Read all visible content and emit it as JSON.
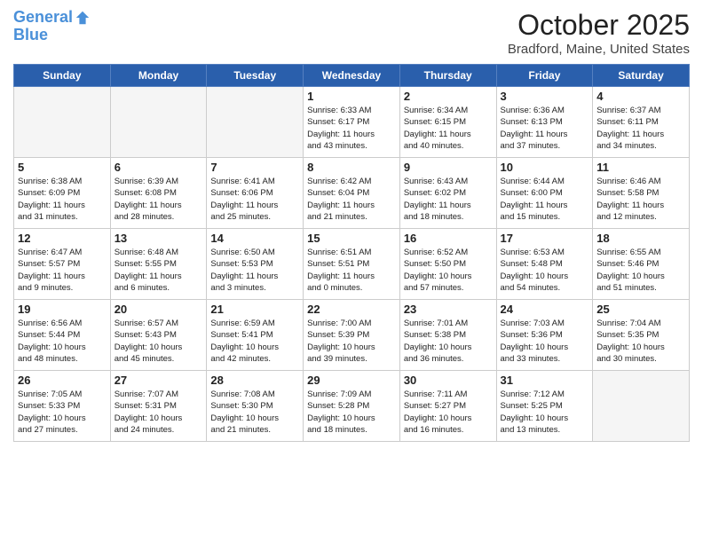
{
  "header": {
    "logo_line1": "General",
    "logo_line2": "Blue",
    "title": "October 2025",
    "subtitle": "Bradford, Maine, United States"
  },
  "weekdays": [
    "Sunday",
    "Monday",
    "Tuesday",
    "Wednesday",
    "Thursday",
    "Friday",
    "Saturday"
  ],
  "weeks": [
    [
      {
        "day": "",
        "info": ""
      },
      {
        "day": "",
        "info": ""
      },
      {
        "day": "",
        "info": ""
      },
      {
        "day": "1",
        "info": "Sunrise: 6:33 AM\nSunset: 6:17 PM\nDaylight: 11 hours\nand 43 minutes."
      },
      {
        "day": "2",
        "info": "Sunrise: 6:34 AM\nSunset: 6:15 PM\nDaylight: 11 hours\nand 40 minutes."
      },
      {
        "day": "3",
        "info": "Sunrise: 6:36 AM\nSunset: 6:13 PM\nDaylight: 11 hours\nand 37 minutes."
      },
      {
        "day": "4",
        "info": "Sunrise: 6:37 AM\nSunset: 6:11 PM\nDaylight: 11 hours\nand 34 minutes."
      }
    ],
    [
      {
        "day": "5",
        "info": "Sunrise: 6:38 AM\nSunset: 6:09 PM\nDaylight: 11 hours\nand 31 minutes."
      },
      {
        "day": "6",
        "info": "Sunrise: 6:39 AM\nSunset: 6:08 PM\nDaylight: 11 hours\nand 28 minutes."
      },
      {
        "day": "7",
        "info": "Sunrise: 6:41 AM\nSunset: 6:06 PM\nDaylight: 11 hours\nand 25 minutes."
      },
      {
        "day": "8",
        "info": "Sunrise: 6:42 AM\nSunset: 6:04 PM\nDaylight: 11 hours\nand 21 minutes."
      },
      {
        "day": "9",
        "info": "Sunrise: 6:43 AM\nSunset: 6:02 PM\nDaylight: 11 hours\nand 18 minutes."
      },
      {
        "day": "10",
        "info": "Sunrise: 6:44 AM\nSunset: 6:00 PM\nDaylight: 11 hours\nand 15 minutes."
      },
      {
        "day": "11",
        "info": "Sunrise: 6:46 AM\nSunset: 5:58 PM\nDaylight: 11 hours\nand 12 minutes."
      }
    ],
    [
      {
        "day": "12",
        "info": "Sunrise: 6:47 AM\nSunset: 5:57 PM\nDaylight: 11 hours\nand 9 minutes."
      },
      {
        "day": "13",
        "info": "Sunrise: 6:48 AM\nSunset: 5:55 PM\nDaylight: 11 hours\nand 6 minutes."
      },
      {
        "day": "14",
        "info": "Sunrise: 6:50 AM\nSunset: 5:53 PM\nDaylight: 11 hours\nand 3 minutes."
      },
      {
        "day": "15",
        "info": "Sunrise: 6:51 AM\nSunset: 5:51 PM\nDaylight: 11 hours\nand 0 minutes."
      },
      {
        "day": "16",
        "info": "Sunrise: 6:52 AM\nSunset: 5:50 PM\nDaylight: 10 hours\nand 57 minutes."
      },
      {
        "day": "17",
        "info": "Sunrise: 6:53 AM\nSunset: 5:48 PM\nDaylight: 10 hours\nand 54 minutes."
      },
      {
        "day": "18",
        "info": "Sunrise: 6:55 AM\nSunset: 5:46 PM\nDaylight: 10 hours\nand 51 minutes."
      }
    ],
    [
      {
        "day": "19",
        "info": "Sunrise: 6:56 AM\nSunset: 5:44 PM\nDaylight: 10 hours\nand 48 minutes."
      },
      {
        "day": "20",
        "info": "Sunrise: 6:57 AM\nSunset: 5:43 PM\nDaylight: 10 hours\nand 45 minutes."
      },
      {
        "day": "21",
        "info": "Sunrise: 6:59 AM\nSunset: 5:41 PM\nDaylight: 10 hours\nand 42 minutes."
      },
      {
        "day": "22",
        "info": "Sunrise: 7:00 AM\nSunset: 5:39 PM\nDaylight: 10 hours\nand 39 minutes."
      },
      {
        "day": "23",
        "info": "Sunrise: 7:01 AM\nSunset: 5:38 PM\nDaylight: 10 hours\nand 36 minutes."
      },
      {
        "day": "24",
        "info": "Sunrise: 7:03 AM\nSunset: 5:36 PM\nDaylight: 10 hours\nand 33 minutes."
      },
      {
        "day": "25",
        "info": "Sunrise: 7:04 AM\nSunset: 5:35 PM\nDaylight: 10 hours\nand 30 minutes."
      }
    ],
    [
      {
        "day": "26",
        "info": "Sunrise: 7:05 AM\nSunset: 5:33 PM\nDaylight: 10 hours\nand 27 minutes."
      },
      {
        "day": "27",
        "info": "Sunrise: 7:07 AM\nSunset: 5:31 PM\nDaylight: 10 hours\nand 24 minutes."
      },
      {
        "day": "28",
        "info": "Sunrise: 7:08 AM\nSunset: 5:30 PM\nDaylight: 10 hours\nand 21 minutes."
      },
      {
        "day": "29",
        "info": "Sunrise: 7:09 AM\nSunset: 5:28 PM\nDaylight: 10 hours\nand 18 minutes."
      },
      {
        "day": "30",
        "info": "Sunrise: 7:11 AM\nSunset: 5:27 PM\nDaylight: 10 hours\nand 16 minutes."
      },
      {
        "day": "31",
        "info": "Sunrise: 7:12 AM\nSunset: 5:25 PM\nDaylight: 10 hours\nand 13 minutes."
      },
      {
        "day": "",
        "info": ""
      }
    ]
  ]
}
